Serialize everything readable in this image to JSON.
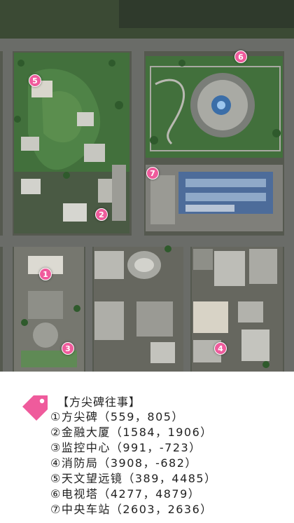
{
  "map": {
    "markers": [
      {
        "num": "5"
      },
      {
        "num": "6"
      },
      {
        "num": "7"
      },
      {
        "num": "2"
      },
      {
        "num": "1"
      },
      {
        "num": "3"
      },
      {
        "num": "4"
      }
    ],
    "colors": {
      "marker": "#ef5b9c",
      "grass": "#3f6b3a",
      "road": "#5b5e5a",
      "plaza": "#8a8a86"
    }
  },
  "legend": {
    "title": "【方尖碑往事】",
    "icon": "price-tag-icon",
    "items": [
      {
        "text": "①方尖碑（559，805）"
      },
      {
        "text": "②金融大厦（1584，1906）"
      },
      {
        "text": "③监控中心（991，-723）"
      },
      {
        "text": "④消防局（3908，-682）"
      },
      {
        "text": "⑤天文望远镜（389，4485）"
      },
      {
        "text": "⑥电视塔（4277，4879）"
      },
      {
        "text": "⑦中央车站（2603，2636）"
      }
    ]
  }
}
